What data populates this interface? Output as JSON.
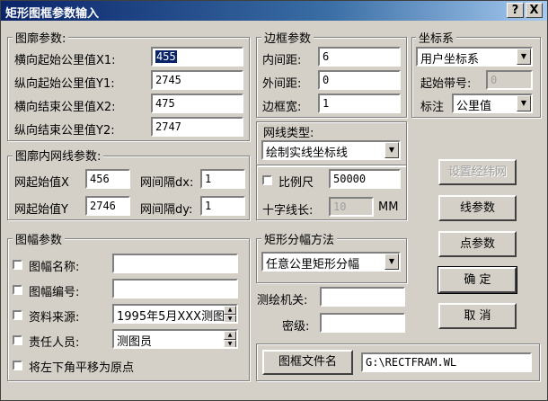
{
  "window": {
    "title": "矩形图框参数输入",
    "help_btn": "?",
    "close_btn": "X"
  },
  "map_extent": {
    "label": "图廓参数:",
    "x1_label": "横向起始公里值X1:",
    "x1": "455",
    "y1_label": "纵向起始公里值Y1:",
    "y1": "2745",
    "x2_label": "横向结束公里值X2:",
    "x2": "475",
    "y2_label": "纵向结束公里值Y2:",
    "y2": "2747"
  },
  "grid": {
    "label": "图廓内网线参数:",
    "x_start_label": "网起始值X",
    "x_start": "456",
    "dx_label": "网间隔dx:",
    "dx": "1",
    "y_start_label": "网起始值Y",
    "y_start": "2746",
    "dy_label": "网间隔dy:",
    "dy": "1"
  },
  "border": {
    "label": "边框参数",
    "inner_label": "内间距:",
    "inner": "6",
    "outer_label": "外间距:",
    "outer": "0",
    "width_label": "边框宽:",
    "width": "1"
  },
  "line_type": {
    "label": "网线类型:",
    "value": "绘制实线坐标线"
  },
  "scale": {
    "checkbox_label": "比例尺",
    "value": "50000",
    "cross_label": "十字线长:",
    "cross": "10",
    "unit": "MM"
  },
  "coord": {
    "label": "坐标系",
    "system": "用户坐标系",
    "start_no_label": "起始带号:",
    "start_no": "0",
    "mark_label": "标注",
    "mark": "公里值"
  },
  "sheet": {
    "label": "图幅参数",
    "name_label": "图幅名称:",
    "name": "",
    "number_label": "图幅编号:",
    "number": "",
    "source_label": "资料来源:",
    "source": "1995年5月XXX测图",
    "person_label": "责任人员:",
    "person": "测图员",
    "origin_label": "将左下角平移为原点"
  },
  "split": {
    "label": "矩形分幅方法",
    "value": "任意公里矩形分幅"
  },
  "org": {
    "agency_label": "测绘机关:",
    "agency": "",
    "secret_label": "密级:",
    "secret": ""
  },
  "file": {
    "button": "图框文件名",
    "path": "G:\\RECTFRAM.WL"
  },
  "buttons": {
    "latlon_grid": "设置经纬网",
    "line_params": "线参数",
    "point_params": "点参数",
    "ok": "确 定",
    "cancel": "取 消"
  }
}
